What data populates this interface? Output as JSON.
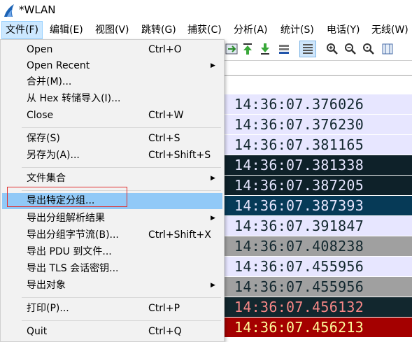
{
  "window": {
    "title": "*WLAN"
  },
  "menubar": {
    "items": [
      "文件(F)",
      "编辑(E)",
      "视图(V)",
      "跳转(G)",
      "捕获(C)",
      "分析(A)",
      "统计(S)",
      "电话(Y)",
      "无线(W)"
    ]
  },
  "file_menu": {
    "items": [
      {
        "label": "Open",
        "shortcut": "Ctrl+O",
        "submenu": false
      },
      {
        "label": "Open Recent",
        "shortcut": "",
        "submenu": true
      },
      {
        "label": "合并(M)...",
        "shortcut": "",
        "submenu": false
      },
      {
        "label": "从 Hex 转储导入(I)...",
        "shortcut": "",
        "submenu": false
      },
      {
        "label": "Close",
        "shortcut": "Ctrl+W",
        "submenu": false
      },
      {
        "label": "保存(S)",
        "shortcut": "Ctrl+S",
        "submenu": false
      },
      {
        "label": "另存为(A)...",
        "shortcut": "Ctrl+Shift+S",
        "submenu": false
      },
      {
        "label": "文件集合",
        "shortcut": "",
        "submenu": true
      },
      {
        "label": "导出特定分组...",
        "shortcut": "",
        "submenu": false,
        "highlighted": true
      },
      {
        "label": "导出分组解析结果",
        "shortcut": "",
        "submenu": true
      },
      {
        "label": "导出分组字节流(B)...",
        "shortcut": "Ctrl+Shift+X",
        "submenu": false
      },
      {
        "label": "导出 PDU 到文件...",
        "shortcut": "",
        "submenu": false
      },
      {
        "label": "导出 TLS 会话密钥...",
        "shortcut": "",
        "submenu": false
      },
      {
        "label": "导出对象",
        "shortcut": "",
        "submenu": true
      },
      {
        "label": "打印(P)...",
        "shortcut": "Ctrl+P",
        "submenu": false
      },
      {
        "label": "Quit",
        "shortcut": "Ctrl+Q",
        "submenu": false
      }
    ]
  },
  "packets": [
    {
      "time": "14:36:07.376026",
      "bg": "#e7e6ff",
      "fg": "#12272e"
    },
    {
      "time": "14:36:07.376230",
      "bg": "#e7e6ff",
      "fg": "#12272e"
    },
    {
      "time": "14:36:07.381165",
      "bg": "#e7e6ff",
      "fg": "#12272e"
    },
    {
      "time": "14:36:07.381338",
      "bg": "#0e2129",
      "fg": "#e7e6ff"
    },
    {
      "time": "14:36:07.387205",
      "bg": "#0e2129",
      "fg": "#e7e6ff"
    },
    {
      "time": "14:36:07.387393",
      "bg": "#063a57",
      "fg": "#e7e6ff"
    },
    {
      "time": "14:36:07.391847",
      "bg": "#e7e6ff",
      "fg": "#12272e"
    },
    {
      "time": "14:36:07.408238",
      "bg": "#a0a0a0",
      "fg": "#12272e"
    },
    {
      "time": "14:36:07.455956",
      "bg": "#e7e6ff",
      "fg": "#12272e"
    },
    {
      "time": "14:36:07.455956",
      "bg": "#a0a0a0",
      "fg": "#12272e"
    },
    {
      "time": "14:36:07.456132",
      "bg": "#12272e",
      "fg": "#f78787"
    },
    {
      "time": "14:36:07.456213",
      "bg": "#a40000",
      "fg": "#fffc9c"
    }
  ],
  "colors": {
    "menu_highlight": "#91c9f7",
    "annotation": "#e03030",
    "active_menu": "#cce8ff"
  }
}
